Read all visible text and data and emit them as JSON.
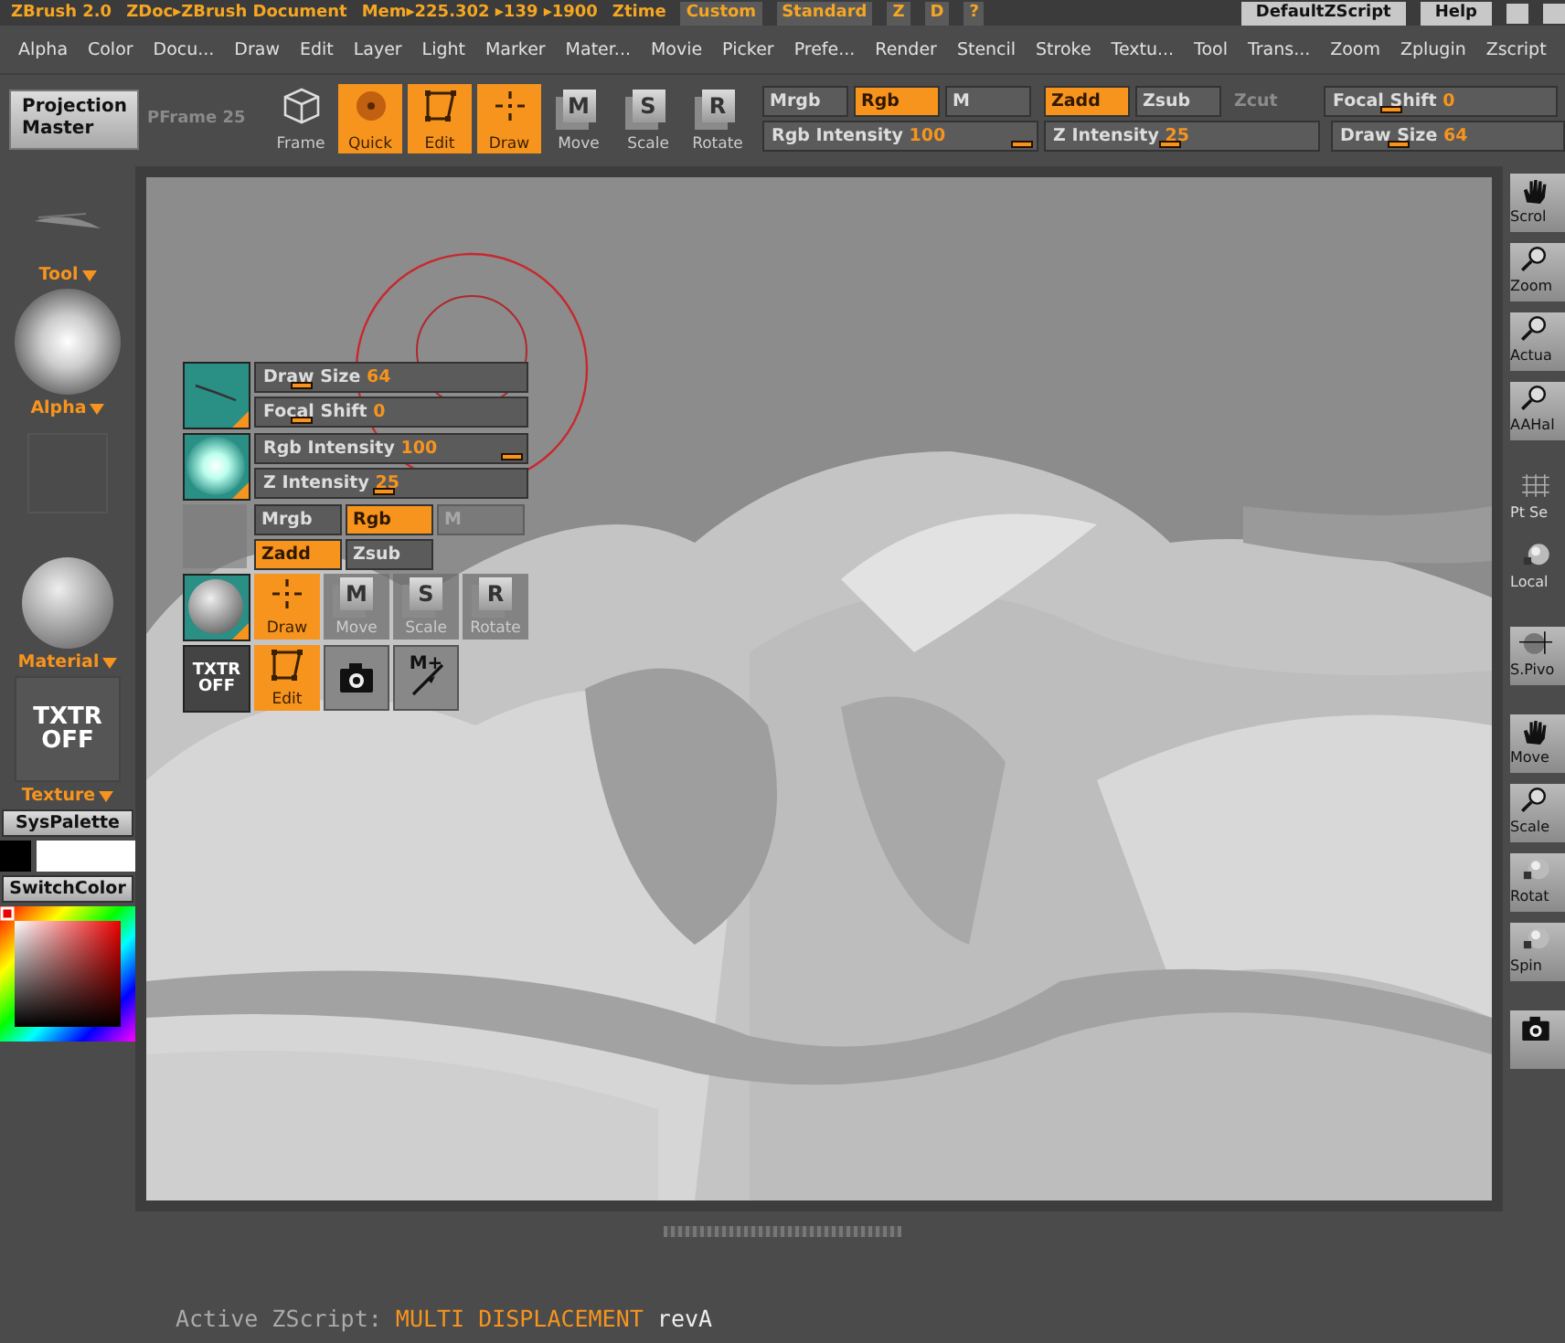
{
  "title_bar": {
    "app": "ZBrush 2.0",
    "document": "ZDoc▸ZBrush Document",
    "memory": "Mem▸225.302 ▸139 ▸1900",
    "ztime": "Ztime",
    "buttons": [
      {
        "label": "Custom",
        "kind": "orange"
      },
      {
        "label": "Standard",
        "kind": "orange"
      },
      {
        "label": "Z",
        "kind": "orange"
      },
      {
        "label": "D",
        "kind": "orange"
      },
      {
        "label": "?",
        "kind": "orange"
      },
      {
        "label": "DefaultZScript",
        "kind": "grey"
      },
      {
        "label": "Help",
        "kind": "grey"
      }
    ]
  },
  "menu": [
    "Alpha",
    "Color",
    "Docu...",
    "Draw",
    "Edit",
    "Layer",
    "Light",
    "Marker",
    "Mater...",
    "Movie",
    "Picker",
    "Prefe...",
    "Render",
    "Stencil",
    "Stroke",
    "Textu...",
    "Tool",
    "Trans...",
    "Zoom",
    "Zplugin",
    "Zscript"
  ],
  "toolbar": {
    "projection_master": "Projection Master",
    "disabled_label": "PFrame 25",
    "tools": [
      {
        "label": "Frame",
        "kind": "cube",
        "selected": false
      },
      {
        "label": "Quick",
        "kind": "quick",
        "selected": true
      },
      {
        "label": "Edit",
        "kind": "edit",
        "selected": true
      },
      {
        "label": "Draw",
        "kind": "draw",
        "selected": true
      },
      {
        "label": "Move",
        "kind": "move",
        "glyph": "M",
        "selected": false
      },
      {
        "label": "Scale",
        "kind": "scale",
        "glyph": "S",
        "selected": false
      },
      {
        "label": "Rotate",
        "kind": "rotate",
        "glyph": "R",
        "selected": false
      }
    ],
    "modes": [
      {
        "label": "Mrgb",
        "selected": false,
        "disabled": false
      },
      {
        "label": "Rgb",
        "selected": true,
        "disabled": false
      },
      {
        "label": "M",
        "selected": false,
        "disabled": false
      },
      {
        "label": "Zadd",
        "selected": true,
        "disabled": false
      },
      {
        "label": "Zsub",
        "selected": false,
        "disabled": false
      },
      {
        "label": "Zcut",
        "selected": false,
        "disabled": true
      }
    ],
    "sliders": [
      {
        "label": "Focal Shift",
        "value": "0",
        "level": 0.25
      },
      {
        "label": "Rgb Intensity",
        "value": "100",
        "level": 1
      },
      {
        "label": "Z Intensity",
        "value": "25",
        "level": 0.45
      },
      {
        "label": "Draw Size",
        "value": "64",
        "level": 0.25
      }
    ]
  },
  "left_panel": {
    "tool": "Tool",
    "alpha": "Alpha",
    "material": "Material",
    "texture_thumb": "TXTR OFF",
    "texture": "Texture",
    "sys_palette": "SysPalette",
    "switch_color": "SwitchColor"
  },
  "floating_palette": {
    "sliders": [
      {
        "label": "Draw Size",
        "value": "64",
        "level": 0.13
      },
      {
        "label": "Focal Shift",
        "value": "0",
        "level": 0.13
      },
      {
        "label": "Rgb Intensity",
        "value": "100",
        "level": 1
      },
      {
        "label": "Z Intensity",
        "value": "25",
        "level": 0.47
      }
    ],
    "modes_row1": [
      {
        "label": "Mrgb",
        "selected": false,
        "disabled": false
      },
      {
        "label": "Rgb",
        "selected": true,
        "disabled": false
      },
      {
        "label": "M",
        "selected": false,
        "disabled": true
      }
    ],
    "modes_row2": [
      {
        "label": "Zadd",
        "selected": true,
        "disabled": false
      },
      {
        "label": "Zsub",
        "selected": false,
        "disabled": false
      }
    ],
    "tools": [
      {
        "label": "Draw",
        "kind": "draw",
        "selected": true
      },
      {
        "label": "Move",
        "kind": "move",
        "glyph": "M",
        "selected": false
      },
      {
        "label": "Scale",
        "kind": "scale",
        "glyph": "S",
        "selected": false
      },
      {
        "label": "Rotate",
        "kind": "rotate",
        "glyph": "R",
        "selected": false
      }
    ],
    "texture_thumb": "TXTR OFF",
    "actions": [
      {
        "label": "Edit",
        "kind": "edit",
        "selected": true
      },
      {
        "kind": "camera",
        "selected": false
      },
      {
        "kind": "mplus",
        "glyph": "M+",
        "selected": false
      }
    ]
  },
  "right_panel": [
    [
      {
        "label": "Scrol",
        "kind": "hand",
        "framed": true
      },
      {
        "label": "Zoom",
        "kind": "zoom",
        "framed": true
      },
      {
        "label": "Actua",
        "kind": "zoom",
        "framed": true
      },
      {
        "label": "AAHal",
        "kind": "zoom",
        "framed": true
      }
    ],
    [
      {
        "label": "Pt Se",
        "kind": "grid",
        "framed": false
      },
      {
        "label": "Local",
        "kind": "sphere",
        "framed": false
      }
    ],
    [
      {
        "label": "S.Pivo",
        "kind": "pivot",
        "framed": true
      }
    ],
    [
      {
        "label": "Move",
        "kind": "hand",
        "framed": true
      },
      {
        "label": "Scale",
        "kind": "zoom",
        "framed": true
      },
      {
        "label": "Rotat",
        "kind": "sphere",
        "framed": true
      },
      {
        "label": "Spin",
        "kind": "sphere",
        "framed": true
      }
    ],
    [
      {
        "kind": "camera",
        "framed": true
      }
    ]
  ],
  "status_bar": {
    "label": "Active ZScript:",
    "script": "MULTI DISPLACEMENT",
    "version": "revA"
  }
}
